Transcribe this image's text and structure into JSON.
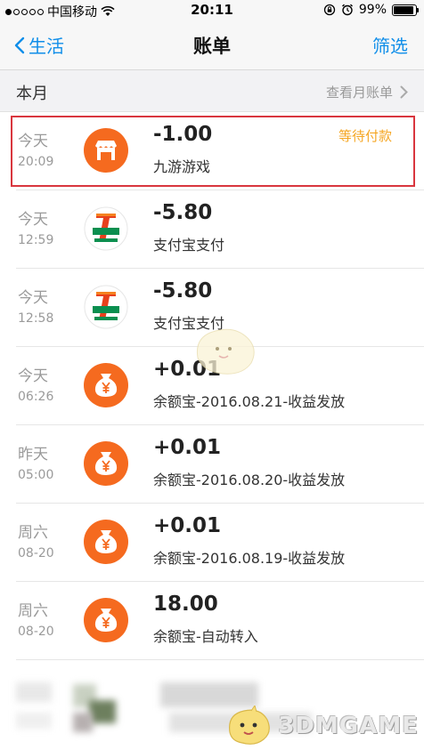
{
  "status_bar": {
    "carrier": "中国移动",
    "time": "20:11",
    "battery": "99%",
    "battery_level": 0.99
  },
  "nav": {
    "back_label": "生活",
    "title": "账单",
    "filter_label": "筛选"
  },
  "section": {
    "title": "本月",
    "link_label": "查看月账单"
  },
  "transactions": [
    {
      "day": "今天",
      "time": "20:09",
      "amount": "-1.00",
      "desc": "九游游戏",
      "status": "等待付款",
      "icon": "shop-icon"
    },
    {
      "day": "今天",
      "time": "12:59",
      "amount": "-5.80",
      "desc": "支付宝支付",
      "status": "",
      "icon": "seven-eleven-logo"
    },
    {
      "day": "今天",
      "time": "12:58",
      "amount": "-5.80",
      "desc": "支付宝支付",
      "status": "",
      "icon": "seven-eleven-logo"
    },
    {
      "day": "今天",
      "time": "06:26",
      "amount": "+0.01",
      "desc": "余额宝-2016.08.21-收益发放",
      "status": "",
      "icon": "money-bag-icon"
    },
    {
      "day": "昨天",
      "time": "05:00",
      "amount": "+0.01",
      "desc": "余额宝-2016.08.20-收益发放",
      "status": "",
      "icon": "money-bag-icon"
    },
    {
      "day": "周六",
      "time": "08-20",
      "amount": "+0.01",
      "desc": "余额宝-2016.08.19-收益发放",
      "status": "",
      "icon": "money-bag-icon"
    },
    {
      "day": "周六",
      "time": "08-20",
      "amount": "18.00",
      "desc": "余额宝-自动转入",
      "status": "",
      "icon": "money-bag-icon"
    }
  ],
  "watermark": "3DMGAME",
  "colors": {
    "accent": "#108ee9",
    "icon_orange": "#f56a1f",
    "pending": "#f5a623",
    "highlight": "#d9363e"
  }
}
